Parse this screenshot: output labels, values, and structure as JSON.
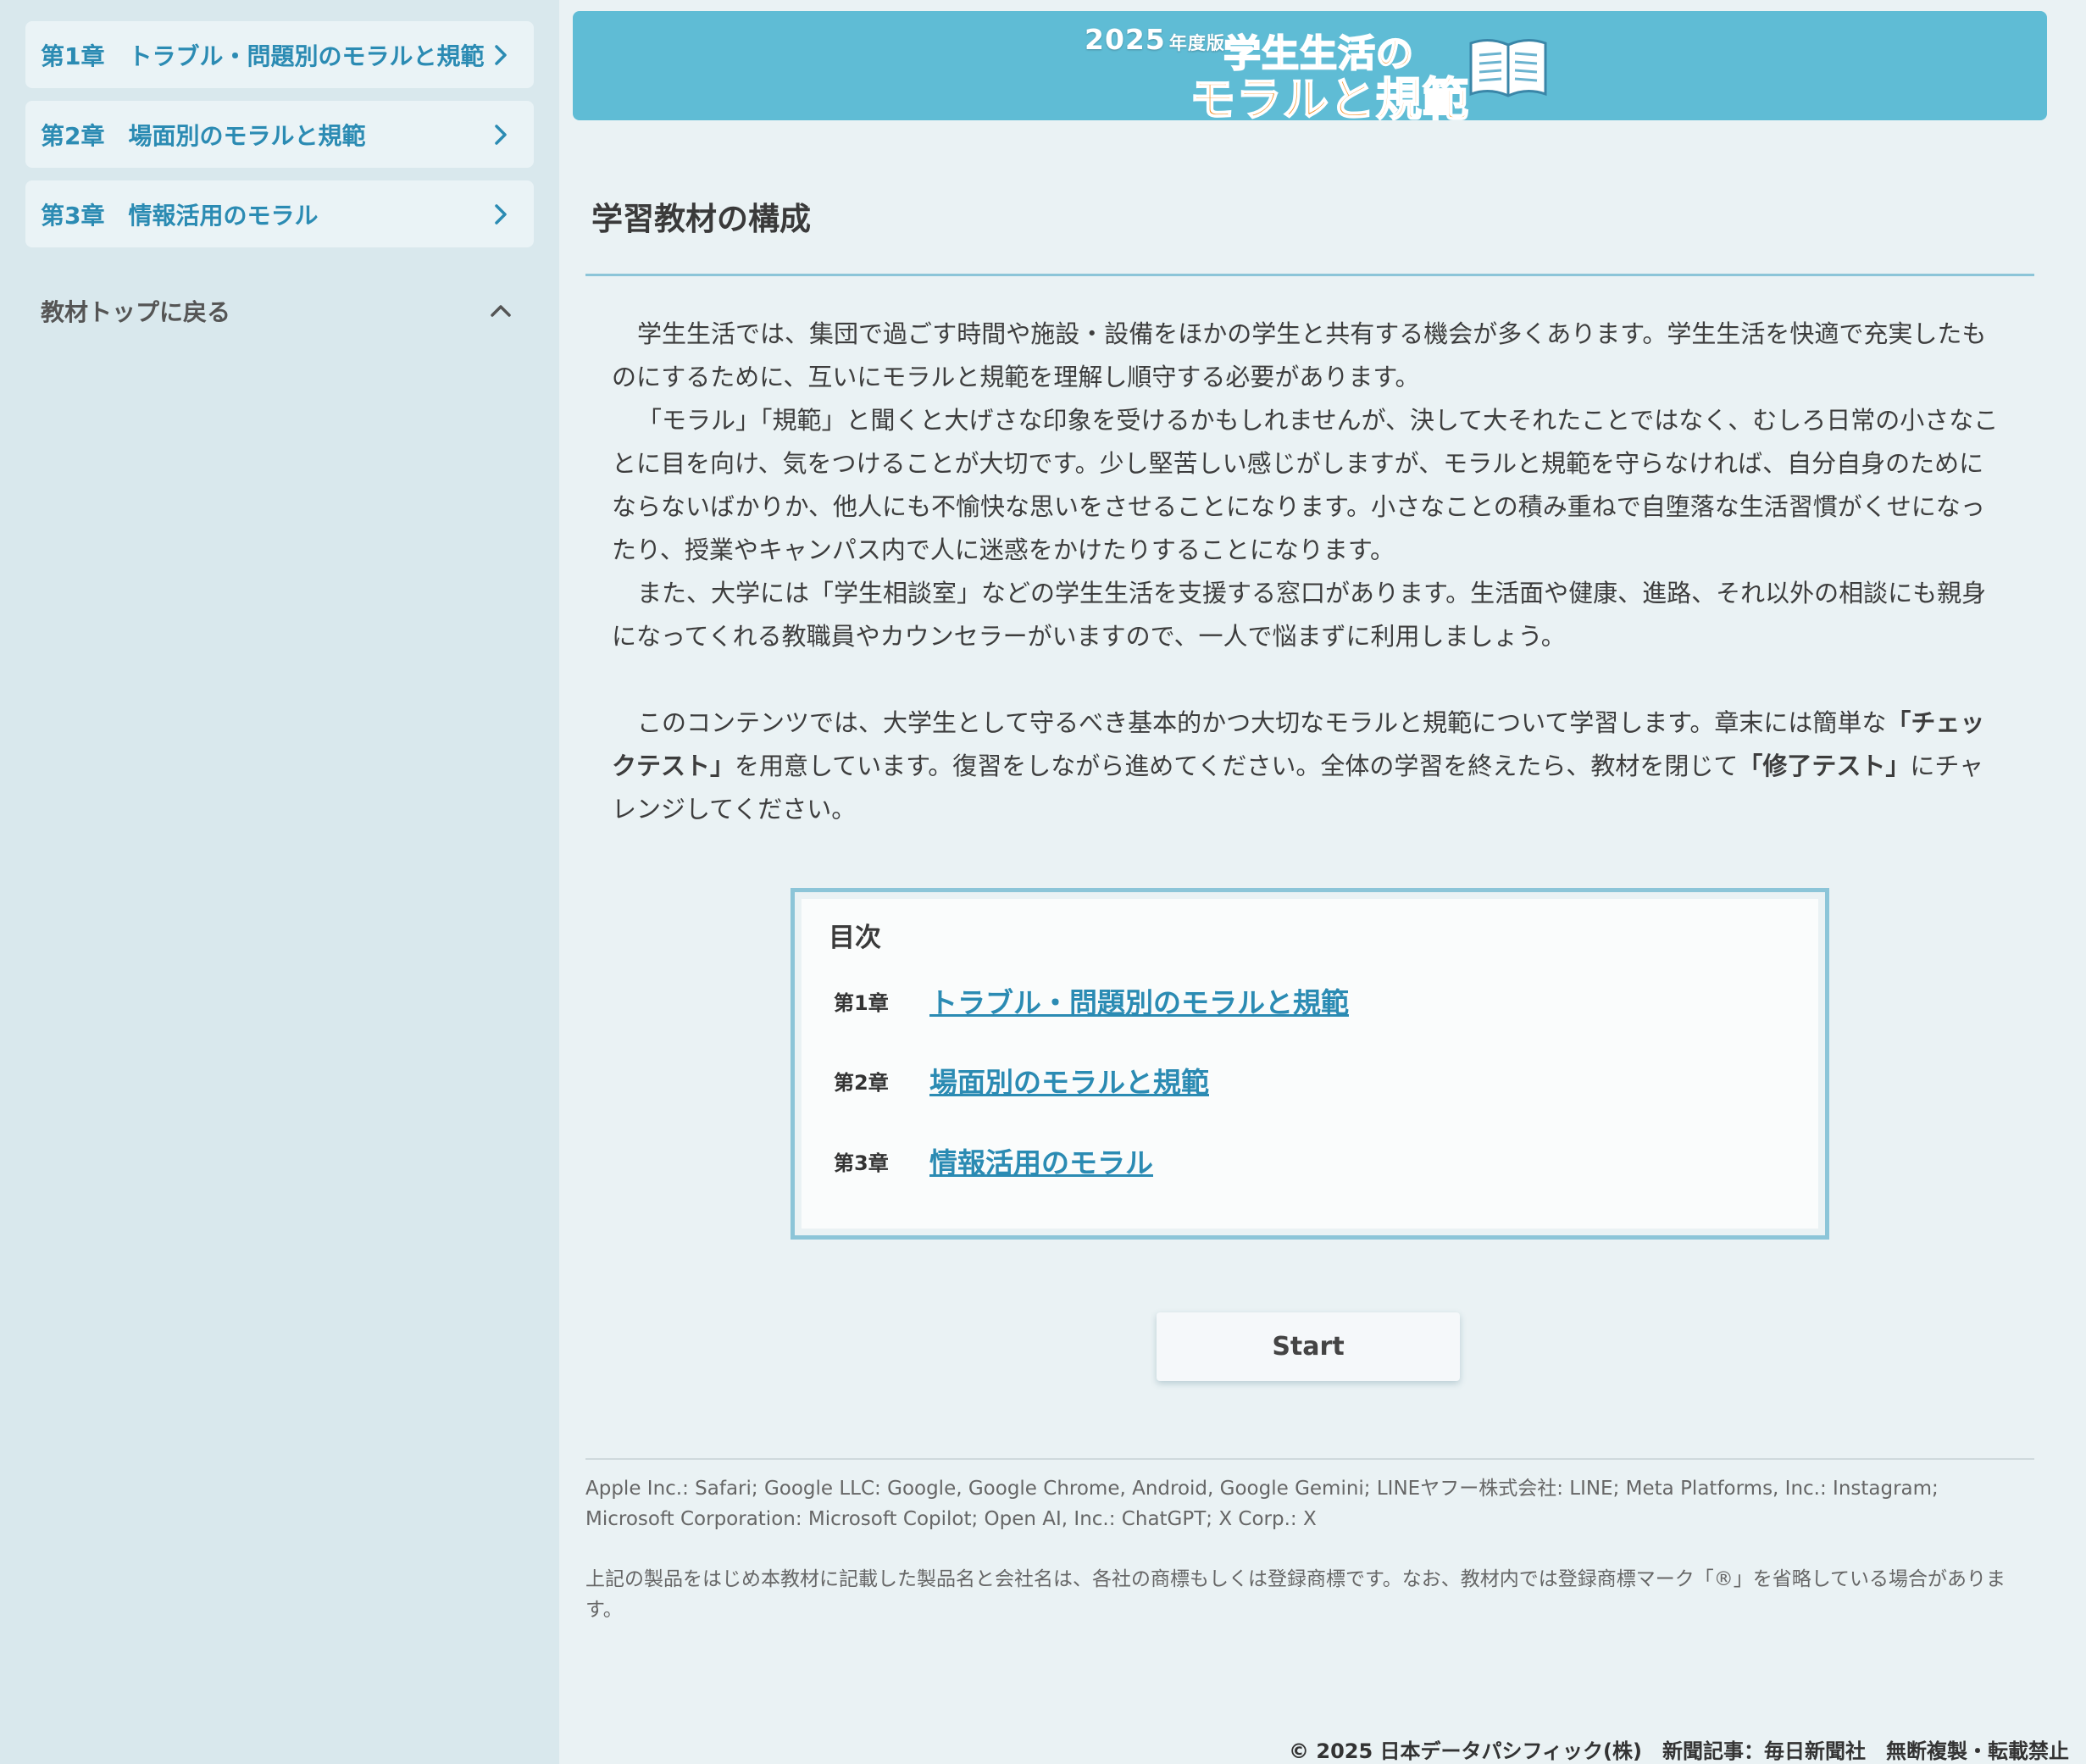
{
  "sidebar": {
    "items": [
      {
        "label": "第1章　トラブル・問題別のモラルと規範"
      },
      {
        "label": "第2章　場面別のモラルと規範"
      },
      {
        "label": "第3章　情報活用のモラル"
      }
    ],
    "back_label": "教材トップに戻る"
  },
  "banner": {
    "year": "2025",
    "year_suffix": "年度版",
    "line1": "学生生活の",
    "line2": "モラルと規範"
  },
  "main": {
    "title": "学習教材の構成",
    "paragraphs": [
      "学生生活では、集団で過ごす時間や施設・設備をほかの学生と共有する機会が多くあります。学生生活を快適で充実したものにするために、互いにモラルと規範を理解し順守する必要があります。",
      "「モラル」「規範」と聞くと大げさな印象を受けるかもしれませんが、決して大それたことではなく、むしろ日常の小さなことに目を向け、気をつけることが大切です。少し堅苦しい感じがしますが、モラルと規範を守らなければ、自分自身のためにならないばかりか、他人にも不愉快な思いをさせることになります。小さなことの積み重ねで自堕落な生活習慣がくせになったり、授業やキャンパス内で人に迷惑をかけたりすることになります。",
      "また、大学には「学生相談室」などの学生生活を支援する窓口があります。生活面や健康、進路、それ以外の相談にも親身になってくれる教職員やカウンセラーがいますので、一人で悩まずに利用しましょう。"
    ],
    "intro": {
      "part1": "このコンテンツでは、大学生として守るべき基本的かつ大切なモラルと規範について学習します。章末には簡単な",
      "bold1": "「チェックテスト」",
      "part2": "を用意しています。復習をしながら進めてください。全体の学習を終えたら、教材を閉じて",
      "bold2": "「修了テスト」",
      "part3": "にチャレンジしてください。"
    }
  },
  "toc": {
    "heading": "目次",
    "rows": [
      {
        "num": "第1章",
        "title": "トラブル・問題別のモラルと規範"
      },
      {
        "num": "第2章",
        "title": "場面別のモラルと規範"
      },
      {
        "num": "第3章",
        "title": "情報活用のモラル"
      }
    ]
  },
  "start_label": "Start",
  "footer": {
    "trademarks": "Apple Inc.: Safari; Google LLC: Google, Google Chrome, Android, Google Gemini; LINEヤフー株式会社: LINE; Meta Platforms, Inc.: Instagram; Microsoft Corporation: Microsoft Copilot; Open AI, Inc.: ChatGPT; X Corp.: X",
    "notice": "上記の製品をはじめ本教材に記載した製品名と会社名は、各社の商標もしくは登録商標です。なお、教材内では登録商標マーク「®」を省略している場合があります。",
    "copyright": "© 2025 日本データパシフィック(株)　新聞記事：毎日新聞社　無断複製・転載禁止"
  },
  "colors": {
    "accent": "#2b8bb3",
    "banner": "#5fbcd5",
    "sidebar_bg": "#d9e8ed",
    "page_bg": "#eaf2f4",
    "rule": "#8cc5d8",
    "title_orange": "#f28b1e"
  }
}
